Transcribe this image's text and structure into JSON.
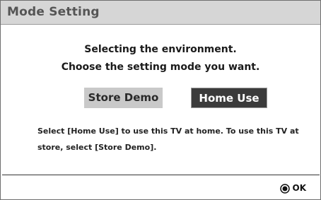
{
  "dialog": {
    "title": "Mode Setting",
    "prompt_line1": "Selecting the environment.",
    "prompt_line2": "Choose the setting mode you want.",
    "options": {
      "store_demo": "Store Demo",
      "home_use": "Home Use",
      "selected": "Home Use"
    },
    "description": "Select [Home Use] to use this TV at home.  To use this TV at store, select [Store Demo].",
    "footer": {
      "ok_icon": "ok-button-icon",
      "ok_label": "OK"
    }
  },
  "colors": {
    "title_bar": "#d6d6d6",
    "selected_button": "#3b3b3b",
    "unselected_button": "#c9c9c9"
  }
}
